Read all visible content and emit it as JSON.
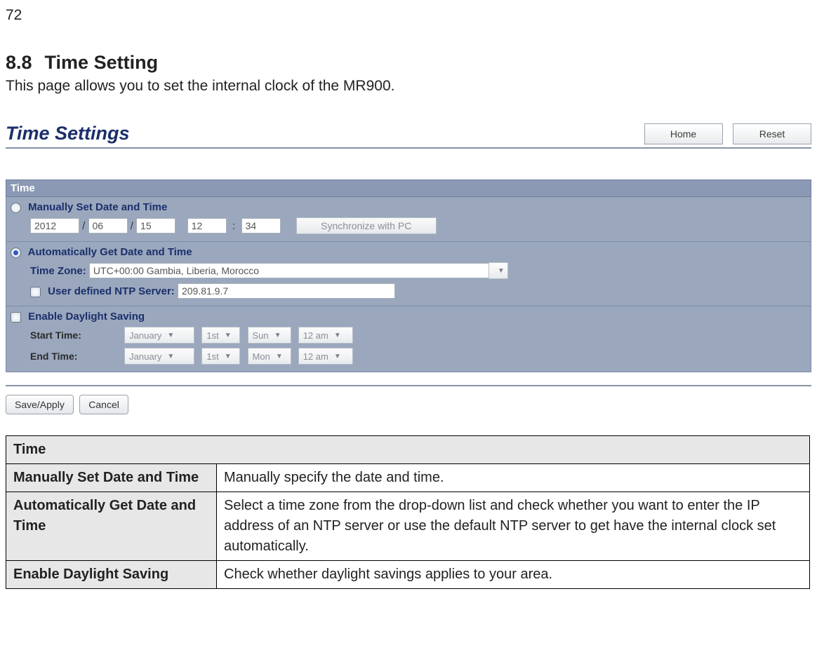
{
  "page_number": "72",
  "section": {
    "number": "8.8",
    "title": "Time Setting"
  },
  "section_desc": "This page allows you to set the internal clock of the MR900.",
  "screenshot": {
    "title": "Time Settings",
    "home_btn": "Home",
    "reset_btn": "Reset",
    "time_header": "Time",
    "manual": {
      "label": "Manually Set Date and Time",
      "year": "2012",
      "month": "06",
      "day": "15",
      "hour": "12",
      "minute": "34",
      "sep_date": "/",
      "sep_time": ":",
      "sync_btn": "Synchronize with PC"
    },
    "auto": {
      "label": "Automatically Get Date and Time",
      "tz_label": "Time Zone:",
      "tz_value": "UTC+00:00 Gambia, Liberia, Morocco",
      "ntp_label": "User defined NTP Server:",
      "ntp_value": "209.81.9.7"
    },
    "daylight": {
      "label": "Enable Daylight Saving",
      "start_label": "Start Time:",
      "end_label": "End Time:",
      "start": {
        "month": "January",
        "week": "1st",
        "day": "Sun",
        "hour": "12 am"
      },
      "end": {
        "month": "January",
        "week": "1st",
        "day": "Mon",
        "hour": "12 am"
      }
    },
    "save_btn": "Save/Apply",
    "cancel_btn": "Cancel"
  },
  "table": {
    "header": "Time",
    "rows": [
      {
        "name": "Manually Set Date and Time",
        "desc": "Manually specify the date and time."
      },
      {
        "name": "Automatically Get Date and Time",
        "desc": "Select a time zone from the drop-down list and check whether you want to enter the IP address of an NTP server or use the default NTP server to get have the internal clock set automatically."
      },
      {
        "name": "Enable Daylight Saving",
        "desc": "Check whether daylight savings applies to your area."
      }
    ]
  }
}
